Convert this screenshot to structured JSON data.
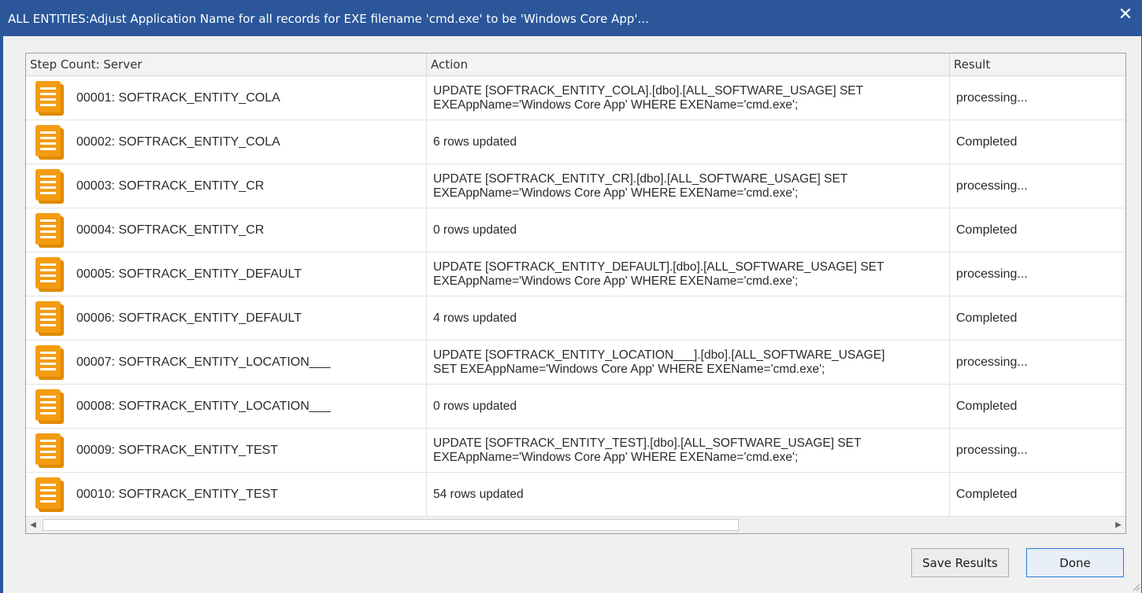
{
  "window": {
    "title": "ALL ENTITIES:Adjust Application Name for all records for EXE filename 'cmd.exe' to be 'Windows Core App'...",
    "close_glyph": "✕"
  },
  "grid": {
    "columns": [
      "Step Count: Server",
      "Action",
      "Result"
    ],
    "rows": [
      {
        "server": "00001: SOFTRACK_ENTITY_COLA",
        "action": "UPDATE [SOFTRACK_ENTITY_COLA].[dbo].[ALL_SOFTWARE_USAGE] SET\nEXEAppName='Windows Core App' WHERE EXEName='cmd.exe';",
        "result": "processing..."
      },
      {
        "server": "00002: SOFTRACK_ENTITY_COLA",
        "action": "6 rows updated",
        "result": "Completed"
      },
      {
        "server": "00003: SOFTRACK_ENTITY_CR",
        "action": "UPDATE [SOFTRACK_ENTITY_CR].[dbo].[ALL_SOFTWARE_USAGE] SET\nEXEAppName='Windows Core App' WHERE EXEName='cmd.exe';",
        "result": "processing..."
      },
      {
        "server": "00004: SOFTRACK_ENTITY_CR",
        "action": "0 rows updated",
        "result": "Completed"
      },
      {
        "server": "00005: SOFTRACK_ENTITY_DEFAULT",
        "action": "UPDATE [SOFTRACK_ENTITY_DEFAULT].[dbo].[ALL_SOFTWARE_USAGE] SET\nEXEAppName='Windows Core App' WHERE EXEName='cmd.exe';",
        "result": "processing..."
      },
      {
        "server": "00006: SOFTRACK_ENTITY_DEFAULT",
        "action": "4 rows updated",
        "result": "Completed"
      },
      {
        "server": "00007: SOFTRACK_ENTITY_LOCATION___",
        "action": "UPDATE [SOFTRACK_ENTITY_LOCATION___].[dbo].[ALL_SOFTWARE_USAGE]\nSET EXEAppName='Windows Core App' WHERE EXEName='cmd.exe';",
        "result": "processing..."
      },
      {
        "server": "00008: SOFTRACK_ENTITY_LOCATION___",
        "action": "0 rows updated",
        "result": "Completed"
      },
      {
        "server": "00009: SOFTRACK_ENTITY_TEST",
        "action": "UPDATE [SOFTRACK_ENTITY_TEST].[dbo].[ALL_SOFTWARE_USAGE] SET\nEXEAppName='Windows Core App' WHERE EXEName='cmd.exe';",
        "result": "processing..."
      },
      {
        "server": "00010: SOFTRACK_ENTITY_TEST",
        "action": "54 rows updated",
        "result": "Completed"
      }
    ],
    "row_icon": "document-icon",
    "scroll": {
      "left_glyph": "◀",
      "right_glyph": "▶"
    }
  },
  "buttons": {
    "save_label": "Save Results",
    "done_label": "Done"
  },
  "colors": {
    "titlebar": "#2b579a",
    "icon_orange": "#f39c12"
  }
}
